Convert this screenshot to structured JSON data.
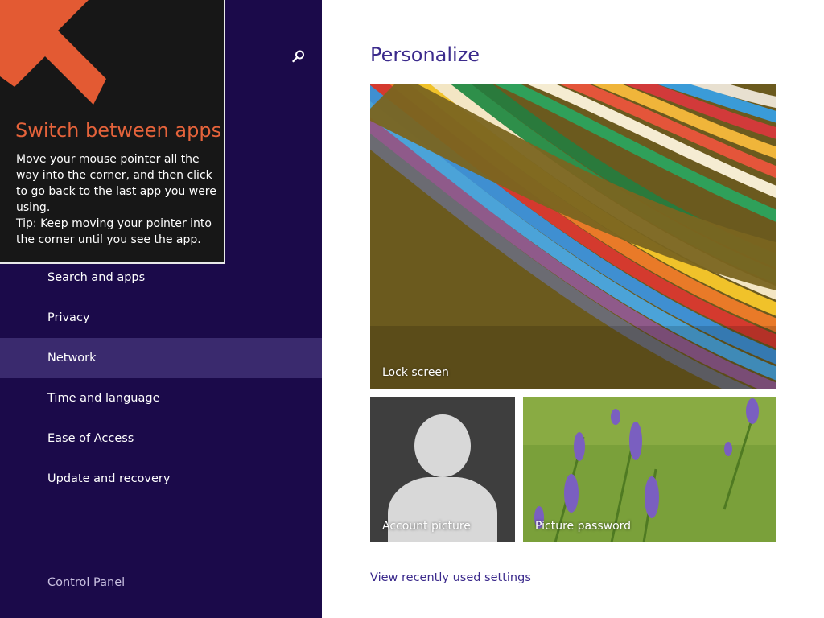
{
  "tip": {
    "title": "Switch between apps",
    "body": "Move your mouse pointer all the way into the corner, and then click to go back to the last app you were using.",
    "tip": "Tip: Keep moving your pointer into the corner until you see the app."
  },
  "sidebar": {
    "items": [
      {
        "label": "Search and apps"
      },
      {
        "label": "Privacy"
      },
      {
        "label": "Network",
        "selected": true
      },
      {
        "label": "Time and language"
      },
      {
        "label": "Ease of Access"
      },
      {
        "label": "Update and recovery"
      }
    ],
    "footer_link": "Control Panel",
    "icon": "search-icon"
  },
  "main": {
    "title": "Personalize",
    "tiles": {
      "lock_screen": "Lock screen",
      "account_picture": "Account picture",
      "picture_password": "Picture password"
    },
    "recent_link": "View recently used settings"
  },
  "colors": {
    "nav_background": "#1b0a4a",
    "nav_selected": "#3a2a6e",
    "accent": "#3b2a8c",
    "tip_title": "#e5633b",
    "tip_background": "#171717"
  }
}
